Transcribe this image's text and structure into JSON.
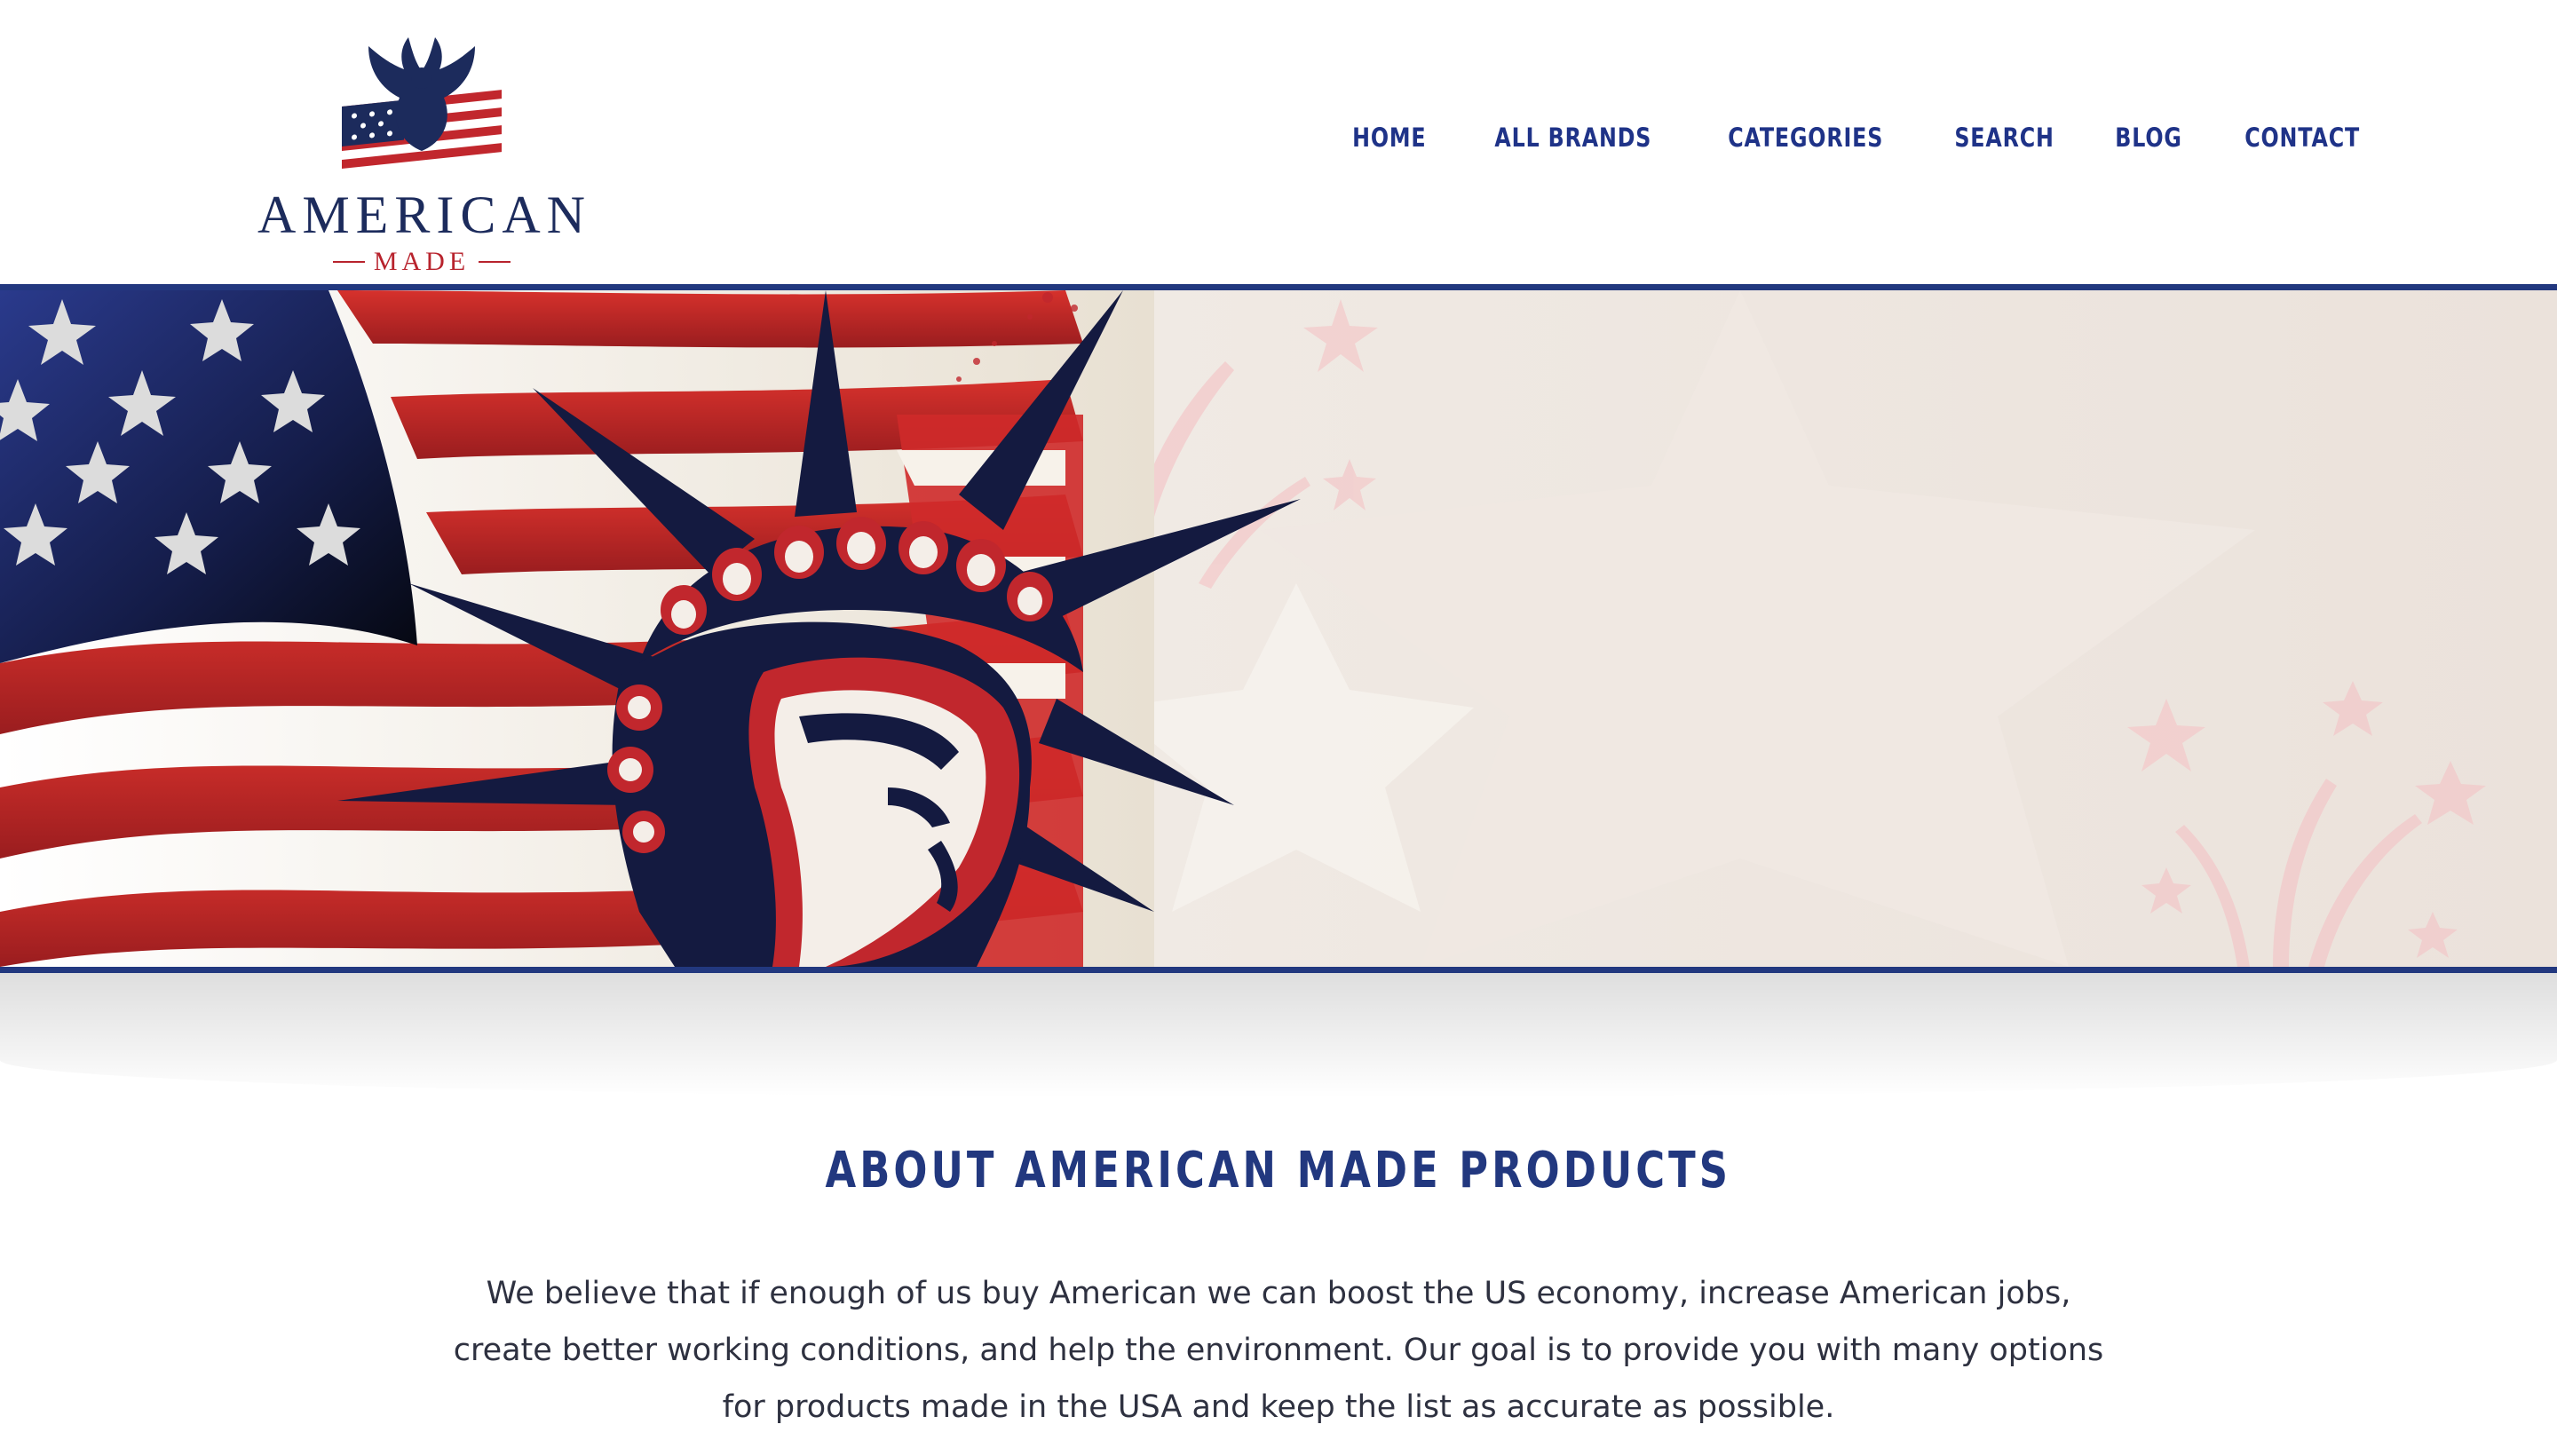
{
  "header": {
    "logo": {
      "title": "AMERICAN",
      "subtitle": "MADE",
      "icon": "eagle-flag-icon"
    },
    "nav": [
      {
        "label": "HOME"
      },
      {
        "label": "ALL BRANDS"
      },
      {
        "label": "CATEGORIES"
      },
      {
        "label": "SEARCH"
      },
      {
        "label": "BLOG"
      },
      {
        "label": "CONTACT"
      }
    ]
  },
  "hero": {
    "image": "statue-of-liberty-flag-banner"
  },
  "about": {
    "title": "ABOUT AMERICAN MADE PRODUCTS",
    "body": "We believe that if enough of us buy American we can boost the US economy, increase American jobs, create better working conditions, and help the environment. Our goal is to provide you with many options for products made in the USA and keep the list as accurate as possible."
  },
  "colors": {
    "navy": "#22387f",
    "nav_text": "#1f3388",
    "red": "#b8232d",
    "hero_bg": "#ece4dc",
    "body_text": "#2e3140"
  }
}
